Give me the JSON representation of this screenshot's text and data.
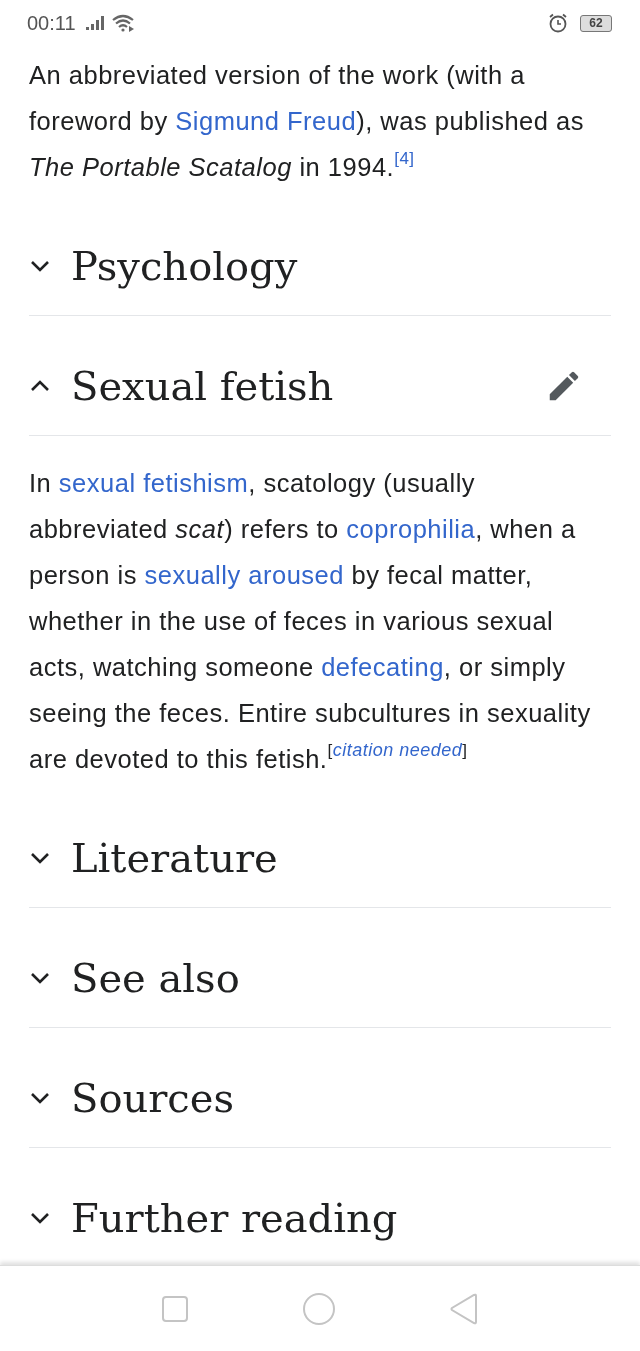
{
  "status_bar": {
    "time": "00:11",
    "battery": "62"
  },
  "intro": [
    {
      "kind": "text",
      "text": "An abbreviated version of the work (with a foreword by "
    },
    {
      "kind": "link",
      "text": "Sigmund Freud"
    },
    {
      "kind": "text",
      "text": "), was published as "
    },
    {
      "kind": "italic",
      "text": "The Portable Scatalog"
    },
    {
      "kind": "text",
      "text": " in 1994."
    },
    {
      "kind": "ref",
      "text": "[4]"
    }
  ],
  "sections": [
    {
      "title": "Psychology",
      "expanded": false,
      "editable": false
    },
    {
      "title": "Sexual fetish",
      "expanded": true,
      "editable": true,
      "body": [
        {
          "kind": "text",
          "text": "In "
        },
        {
          "kind": "link",
          "text": "sexual fetishism"
        },
        {
          "kind": "text",
          "text": ", scatology (usually abbreviated "
        },
        {
          "kind": "italic",
          "text": "scat"
        },
        {
          "kind": "text",
          "text": ") refers to "
        },
        {
          "kind": "link",
          "text": "coprophilia"
        },
        {
          "kind": "text",
          "text": ", when a person is "
        },
        {
          "kind": "link",
          "text": "sexually aroused"
        },
        {
          "kind": "text",
          "text": " by fecal matter, whether in the use of feces in various sexual acts, watching someone "
        },
        {
          "kind": "link",
          "text": "defecating"
        },
        {
          "kind": "text",
          "text": ", or simply seeing the feces. Entire subcultures in sexuality are devoted to this fetish."
        },
        {
          "kind": "sup",
          "text": "["
        },
        {
          "kind": "cite",
          "text": "citation needed"
        },
        {
          "kind": "sup",
          "text": "]"
        }
      ]
    },
    {
      "title": "Literature",
      "expanded": false,
      "editable": false
    },
    {
      "title": "See also",
      "expanded": false,
      "editable": false
    },
    {
      "title": "Sources",
      "expanded": false,
      "editable": false
    },
    {
      "title": "Further reading",
      "expanded": false,
      "editable": false
    }
  ]
}
